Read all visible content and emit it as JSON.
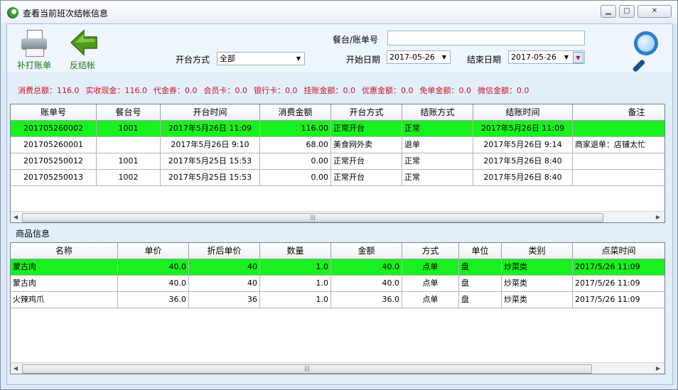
{
  "window": {
    "title": "查看当前班次结帐信息"
  },
  "toolbar": {
    "reprint_label": "补打账单",
    "unsettle_label": "反结帐",
    "table_bill_label": "餐台/账单号",
    "table_bill_value": "",
    "open_mode_label": "开台方式",
    "open_mode_value": "全部",
    "start_date_label": "开始日期",
    "start_date_value": "2017-05-26",
    "end_date_label": "结束日期",
    "end_date_value": "2017-05-26"
  },
  "summary": [
    "消费总额：116.0",
    "实收现金：116.0",
    "代金券：0.0",
    "会员卡：0.0",
    "银行卡：0.0",
    "挂账金额：0.0",
    "优惠金额：0.0",
    "免单金额：0.0",
    "微信金额：0.0"
  ],
  "bills": {
    "headers": [
      "账单号",
      "餐台号",
      "开台时间",
      "消费金额",
      "开台方式",
      "结账方式",
      "结账时间",
      "备注"
    ],
    "rows": [
      [
        "201705260002",
        "1001",
        "2017年5月26日 11:09",
        "116.00",
        "正常开台",
        "正常",
        "2017年5月26日 11:09",
        ""
      ],
      [
        "201705260001",
        "",
        "2017年5月26日 9:10",
        "68.00",
        "美食网外卖",
        "退单",
        "2017年5月26日 9:14",
        "商家退单：店铺太忙"
      ],
      [
        "201705250012",
        "1001",
        "2017年5月25日 15:53",
        "0.00",
        "正常开台",
        "正常",
        "2017年5月26日 8:40",
        ""
      ],
      [
        "201705250013",
        "1002",
        "2017年5月25日 15:53",
        "0.00",
        "正常开台",
        "正常",
        "2017年5月26日 8:40",
        ""
      ]
    ]
  },
  "items_section_label": "商品信息",
  "items": {
    "headers": [
      "名称",
      "单价",
      "折后单价",
      "数量",
      "金额",
      "方式",
      "单位",
      "类别",
      "点菜时间"
    ],
    "rows": [
      [
        "蒙古肉",
        "40.0",
        "40",
        "1.0",
        "40.0",
        "点单",
        "盘",
        "炒菜类",
        "2017/5/26 11:09"
      ],
      [
        "蒙古肉",
        "40.0",
        "40",
        "1.0",
        "40.0",
        "点单",
        "盘",
        "炒菜类",
        "2017/5/26 11:09"
      ],
      [
        "火辣鸡爪",
        "36.0",
        "36",
        "1.0",
        "36.0",
        "点单",
        "盘",
        "炒菜类",
        "2017/5/26 11:09"
      ]
    ]
  },
  "colors": {
    "selected_row": "#19f01f",
    "summary_text": "#c8141e",
    "tool_text": "#1a7a1a"
  },
  "icons": {
    "app": "app-logo-icon",
    "reprint": "printer-icon",
    "unsettle": "back-arrow-icon",
    "search": "magnifier-icon",
    "minimize": "minimize-icon",
    "maximize": "maximize-icon",
    "close": "close-icon",
    "scroll_grip": "scroll-grip-icon"
  },
  "glyphs": {
    "dropdown": "▼",
    "scroll_left": "◀",
    "scroll_right": "▶",
    "grip": "|||"
  }
}
